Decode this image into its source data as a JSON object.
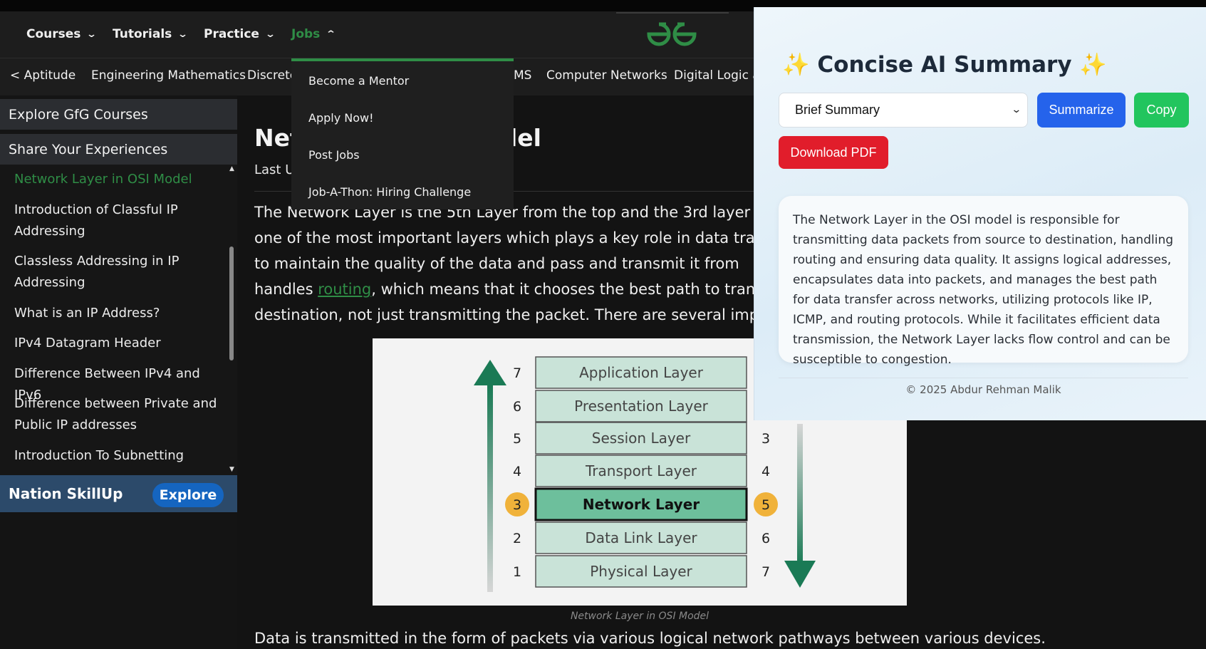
{
  "nav": {
    "items": [
      {
        "label": "Courses"
      },
      {
        "label": "Tutorials"
      },
      {
        "label": "Practice"
      },
      {
        "label": "Jobs"
      }
    ]
  },
  "subnav": {
    "items": [
      "Aptitude",
      "Engineering Mathematics",
      "Discrete",
      "MS",
      "Computer Networks",
      "Digital Logic ar"
    ]
  },
  "sidebar": {
    "buttons": [
      "Explore GfG Courses",
      "Share Your Experiences"
    ],
    "items": [
      "Network Layer in OSI Model",
      "Introduction of Classful IP Addressing",
      "Classless Addressing in IP Addressing",
      "What is an IP Address?",
      "IPv4 Datagram Header",
      "Difference Between IPv4 and IPv6",
      "Difference between Private and Public IP addresses",
      "Introduction To Subnetting"
    ],
    "skillup": {
      "label": "Nation SkillUp",
      "button": "Explore"
    }
  },
  "jobs_menu": {
    "items": [
      "Become a Mentor",
      "Apply Now!",
      "Post Jobs",
      "Job-A-Thon: Hiring Challenge"
    ]
  },
  "article": {
    "title_left": "Net",
    "title_right": "odel",
    "updated": "Last U",
    "para": {
      "line1": "The Network Layer is the 5th Layer from the top and the 3rd layer fr",
      "line2": "one of the most important layers which plays a key role in data trans",
      "line3": "to maintain the quality of the data and pass and transmit it from",
      "line4_pre": "handles ",
      "line4_link": "routing",
      "line4_post": ", which means that it chooses the best path to tran",
      "line5": "destination, not just transmitting the packet. There are several impor"
    },
    "caption": "Network Layer in OSI Model",
    "last_para": "Data is transmitted in the form of packets via various logical network pathways between various devices."
  },
  "figure": {
    "layers": [
      "Application Layer",
      "Presentation Layer",
      "Session Layer",
      "Transport Layer",
      "Network Layer",
      "Data Link Layer",
      "Physical Layer"
    ],
    "left_numbers": [
      "7",
      "6",
      "5",
      "4",
      "3",
      "2",
      "1"
    ],
    "right_numbers": [
      "3",
      "4",
      "5",
      "6",
      "7"
    ],
    "highlight_color": "#6dbf9c",
    "layer_color": "#c9e3d8",
    "arrow_color": "#1a7a55",
    "badge_color": "#f0b23a"
  },
  "summary_panel": {
    "title": "Concise AI Summary",
    "sparkle": "✨",
    "select_value": "Brief Summary",
    "summarize_label": "Summarize",
    "copy_label": "Copy",
    "pdf_label": "Download PDF",
    "summary_text": "The Network Layer in the OSI model is responsible for transmitting data packets from source to destination, handling routing and ensuring data quality. It assigns logical addresses, encapsulates data into packets, and manages the best path for data transfer across networks, utilizing protocols like IP, ICMP, and routing protocols. While it facilitates efficient data transmission, the Network Layer lacks flow control and can be susceptible to congestion.",
    "footer": "© 2025 Abdur Rehman Malik"
  },
  "colors": {
    "brand_green": "#2f8d46",
    "summarize_blue": "#2563eb",
    "copy_green": "#22c55e",
    "pdf_red": "#e11d2b"
  }
}
